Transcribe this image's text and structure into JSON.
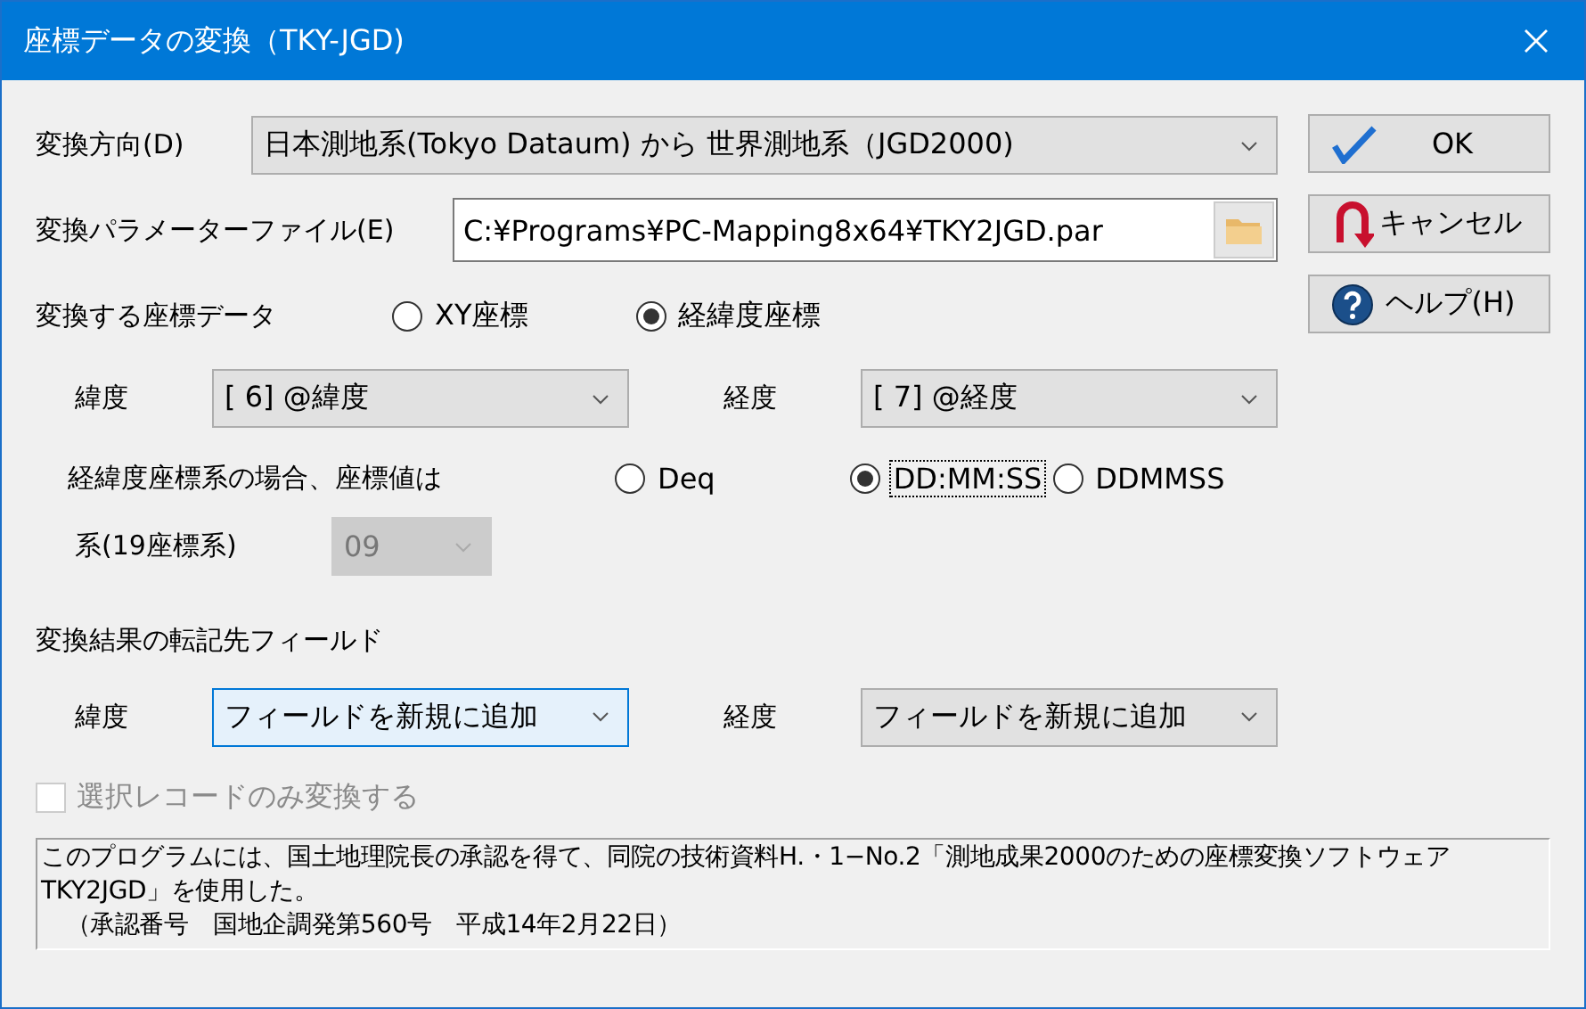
{
  "window": {
    "title": "座標データの変換（TKY-JGD)"
  },
  "direction": {
    "label": "変換方向(D)",
    "value": "日本測地系(Tokyo Dataum) から 世界測地系（JGD2000)"
  },
  "param_file": {
    "label": "変換パラメーターファイル(E)",
    "value": "C:¥Programs¥PC-Mapping8x64¥TKY2JGD.par"
  },
  "coord_type": {
    "label": "変換する座標データ",
    "options": [
      {
        "label": "XY座標",
        "selected": false
      },
      {
        "label": "経緯度座標",
        "selected": true
      }
    ]
  },
  "source_fields": [
    {
      "label": "緯度",
      "value": "[ 6] @緯度"
    },
    {
      "label": "経度",
      "value": "[ 7] @経度"
    }
  ],
  "format": {
    "label": "経緯度座標系の場合、座標値は",
    "options": [
      {
        "label": "Deq",
        "selected": false,
        "focused": false
      },
      {
        "label": "DD:MM:SS",
        "selected": true,
        "focused": true
      },
      {
        "label": "DDMMSS",
        "selected": false,
        "focused": false
      }
    ]
  },
  "zone": {
    "label": "系(19座標系)",
    "value": "09",
    "disabled": true
  },
  "dest_section": {
    "label": "変換結果の転記先フィールド"
  },
  "dest_fields": [
    {
      "label": "緯度",
      "value": "フィールドを新規に追加",
      "focused": true
    },
    {
      "label": "経度",
      "value": "フィールドを新規に追加",
      "focused": false
    }
  ],
  "selected_only": {
    "label": "選択レコードのみ変換する",
    "checked": false,
    "disabled": true
  },
  "note": [
    "このプログラムには、国土地理院長の承認を得て、同院の技術資料H.・1−No.2「測地成果2000のための座標変換ソフトウェアTKY2JGD」を使用した。",
    "　（承認番号　国地企調発第560号　平成14年2月22日）"
  ],
  "buttons": [
    {
      "label": "OK",
      "kind": "ok"
    },
    {
      "label": "キャンセル",
      "kind": "cancel"
    },
    {
      "label": "ヘルプ(H)",
      "kind": "help"
    }
  ]
}
